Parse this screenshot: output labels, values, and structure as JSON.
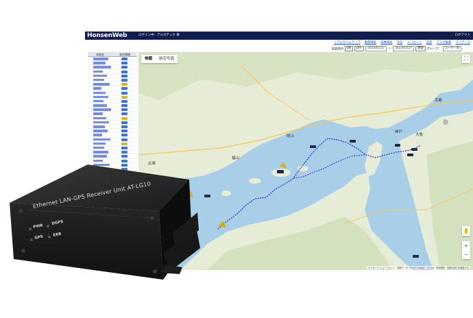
{
  "app": {
    "brand": "HonsenWeb",
    "login_text": "ログイン中：アルカテック 様",
    "logout_label": "ログアウト"
  },
  "nav_links": [
    "リアルタイムマップ",
    "動態検索",
    "画像検索",
    "天気",
    "メッセージ",
    "設定",
    "マスタ編集",
    "マイデータ"
  ],
  "filter": {
    "period_label": "航跡表示",
    "on_label": "ON",
    "off_label": "OFF",
    "date_from": "2023/02/22",
    "tilde": "～",
    "date_to": "2023/02/27",
    "update_label": "更新",
    "group_label": "グループ：",
    "group_value": "ユーザー毎"
  },
  "shiplist": {
    "col_name": "本船名",
    "col_status": "発注情報"
  },
  "map": {
    "tab_map": "地図",
    "tab_satellite": "航空写真",
    "fullscreen_icon": "⛶",
    "zoom_in": "+",
    "zoom_out": "−",
    "attribution": "キーボード ショートカット　地図データ ©2023 Google　20 km　利用規約　地図の誤りを報告する",
    "labels": {
      "kyoto": "京都",
      "osaka": "大阪",
      "kobe": "神戸",
      "okayama": "岡山",
      "hiroshima": "広島",
      "fukuyama": "福山"
    },
    "colors": {
      "sea": "#a9cfe8",
      "land": "#e8eed9",
      "track": "#2828d8"
    }
  },
  "device": {
    "title": "Ethernet LAN-GPS Receiver Unit AT-LG10",
    "led_pwr": "PWR",
    "led_dgps": "DGPS",
    "led_gps": "GPS",
    "led_err": "ERR"
  }
}
